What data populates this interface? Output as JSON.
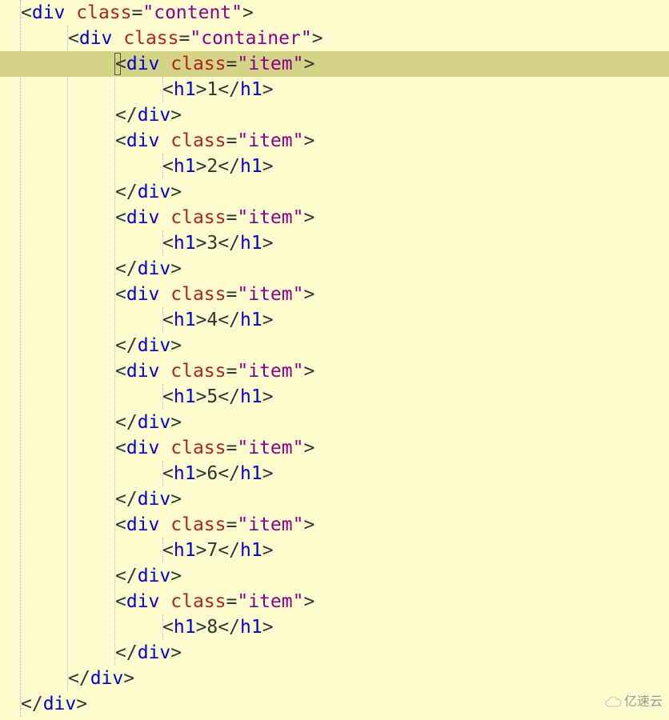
{
  "code": {
    "lines": [
      {
        "indent": 0,
        "type": "open",
        "tag": "div",
        "attr": "class",
        "val": "content",
        "hl": false
      },
      {
        "indent": 1,
        "type": "open",
        "tag": "div",
        "attr": "class",
        "val": "container",
        "hl": false
      },
      {
        "indent": 2,
        "type": "open",
        "tag": "div",
        "attr": "class",
        "val": "item",
        "hl": true,
        "cursor": true
      },
      {
        "indent": 3,
        "type": "leaf",
        "tag": "h1",
        "text": "1",
        "hl": false
      },
      {
        "indent": 2,
        "type": "close",
        "tag": "div",
        "hl": false
      },
      {
        "indent": 2,
        "type": "open",
        "tag": "div",
        "attr": "class",
        "val": "item",
        "hl": false
      },
      {
        "indent": 3,
        "type": "leaf",
        "tag": "h1",
        "text": "2",
        "hl": false
      },
      {
        "indent": 2,
        "type": "close",
        "tag": "div",
        "hl": false
      },
      {
        "indent": 2,
        "type": "open",
        "tag": "div",
        "attr": "class",
        "val": "item",
        "hl": false
      },
      {
        "indent": 3,
        "type": "leaf",
        "tag": "h1",
        "text": "3",
        "hl": false
      },
      {
        "indent": 2,
        "type": "close",
        "tag": "div",
        "hl": false
      },
      {
        "indent": 2,
        "type": "open",
        "tag": "div",
        "attr": "class",
        "val": "item",
        "hl": false
      },
      {
        "indent": 3,
        "type": "leaf",
        "tag": "h1",
        "text": "4",
        "hl": false
      },
      {
        "indent": 2,
        "type": "close",
        "tag": "div",
        "hl": false
      },
      {
        "indent": 2,
        "type": "open",
        "tag": "div",
        "attr": "class",
        "val": "item",
        "hl": false
      },
      {
        "indent": 3,
        "type": "leaf",
        "tag": "h1",
        "text": "5",
        "hl": false
      },
      {
        "indent": 2,
        "type": "close",
        "tag": "div",
        "hl": false
      },
      {
        "indent": 2,
        "type": "open",
        "tag": "div",
        "attr": "class",
        "val": "item",
        "hl": false
      },
      {
        "indent": 3,
        "type": "leaf",
        "tag": "h1",
        "text": "6",
        "hl": false
      },
      {
        "indent": 2,
        "type": "close",
        "tag": "div",
        "hl": false
      },
      {
        "indent": 2,
        "type": "open",
        "tag": "div",
        "attr": "class",
        "val": "item",
        "hl": false
      },
      {
        "indent": 3,
        "type": "leaf",
        "tag": "h1",
        "text": "7",
        "hl": false
      },
      {
        "indent": 2,
        "type": "close",
        "tag": "div",
        "hl": false
      },
      {
        "indent": 2,
        "type": "open",
        "tag": "div",
        "attr": "class",
        "val": "item",
        "hl": false
      },
      {
        "indent": 3,
        "type": "leaf",
        "tag": "h1",
        "text": "8",
        "hl": false
      },
      {
        "indent": 2,
        "type": "close",
        "tag": "div",
        "hl": false
      },
      {
        "indent": 1,
        "type": "close",
        "tag": "div",
        "hl": false
      },
      {
        "indent": 0,
        "type": "close",
        "tag": "div",
        "hl": false
      }
    ]
  },
  "watermark": "亿速云"
}
